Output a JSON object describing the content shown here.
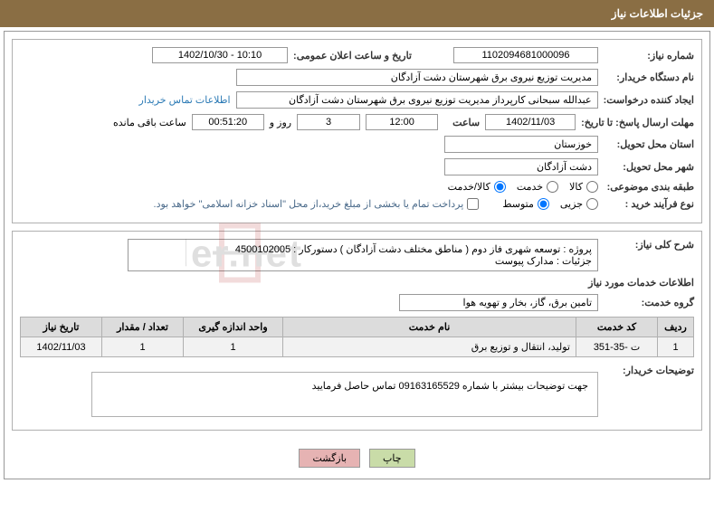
{
  "header": {
    "title": "جزئیات اطلاعات نیاز"
  },
  "fields": {
    "need_number_label": "شماره نیاز:",
    "need_number_value": "1102094681000096",
    "announce_label": "تاریخ و ساعت اعلان عمومی:",
    "announce_value": "1402/10/30 - 10:10",
    "buyer_org_label": "نام دستگاه خریدار:",
    "buyer_org_value": "مدیریت توزیع نیروی برق شهرستان دشت آزادگان",
    "requester_label": "ایجاد کننده درخواست:",
    "requester_value": "عبدالله سبحانی کارپرداز مدیریت توزیع نیروی برق شهرستان دشت آزادگان",
    "contact_link": "اطلاعات تماس خریدار",
    "deadline_label": "مهلت ارسال پاسخ: تا تاریخ:",
    "deadline_date": "1402/11/03",
    "time_label": "ساعت",
    "deadline_time": "12:00",
    "days_value": "3",
    "days_suffix": "روز و",
    "remaining_time": "00:51:20",
    "remaining_suffix": "ساعت باقی مانده",
    "province_label": "استان محل تحویل:",
    "province_value": "خوزستان",
    "city_label": "شهر محل تحویل:",
    "city_value": "دشت آزادگان",
    "category_label": "طبقه بندی موضوعی:",
    "cat_kala": "کالا",
    "cat_khedmat": "خدمت",
    "cat_kalakhedmat": "کالا/خدمت",
    "purchase_type_label": "نوع فرآیند خرید :",
    "type_jozei": "جزیی",
    "type_motavaset": "متوسط",
    "payment_note": "پرداخت تمام یا بخشی از مبلغ خرید،از محل \"اسناد خزانه اسلامی\" خواهد بود."
  },
  "description": {
    "general_label": "شرح کلی نیاز:",
    "general_value": "پروژه : توسعه شهری فاز دوم ( مناطق مختلف دشت آزادگان )  دستورکار : 4500102005\nجزئیات : مدارک پیوست",
    "service_info_title": "اطلاعات خدمات مورد نیاز",
    "service_group_label": "گروه خدمت:",
    "service_group_value": "تامین برق، گاز، بخار و تهویه هوا"
  },
  "table": {
    "headers": {
      "row": "ردیف",
      "code": "کد خدمت",
      "name": "نام خدمت",
      "unit": "واحد اندازه گیری",
      "qty": "تعداد / مقدار",
      "date": "تاریخ نیاز"
    },
    "rows": [
      {
        "row": "1",
        "code": "ت -35-351",
        "name": "تولید، انتقال و توزیع برق",
        "unit": "1",
        "qty": "1",
        "date": "1402/11/03"
      }
    ]
  },
  "buyer_desc": {
    "label": "توضیحات خریدار:",
    "value": "جهت توضیحات بیشتر با شماره 09163165529 تماس حاصل فرمایید"
  },
  "buttons": {
    "print": "چاپ",
    "back": "بازگشت"
  }
}
